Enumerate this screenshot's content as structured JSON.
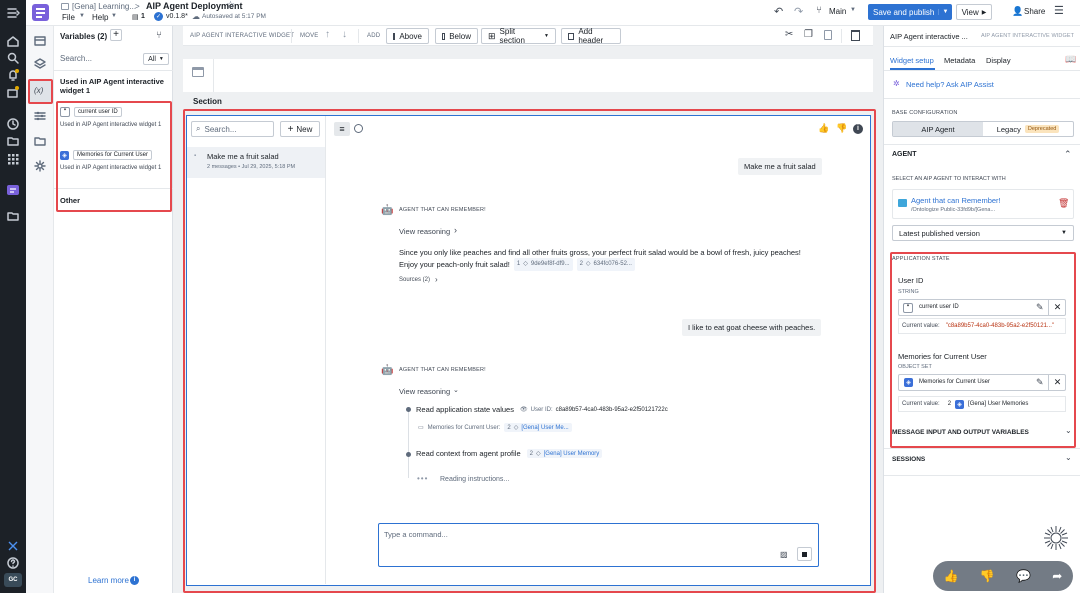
{
  "topbar": {
    "breadcrumb_parent": "[Gena] Learning...",
    "breadcrumb_sep": ">",
    "title": "AIP Agent Deployment",
    "menu_file": "File",
    "menu_help": "Help",
    "count": "1",
    "version": "v0.1.8*",
    "autosave": "Autosaved at 5:17 PM",
    "branch": "Main",
    "save_publish": "Save and publish",
    "view": "View",
    "share": "Share"
  },
  "variables": {
    "title": "Variables (2)",
    "search_placeholder": "Search...",
    "filter": "All",
    "section_used": "Used in AIP Agent interactive widget 1",
    "items": [
      {
        "name": "current user ID",
        "usage_prefix": "Used in",
        "usage": "AIP Agent interactive widget 1"
      },
      {
        "name": "Memories for Current User",
        "usage_prefix": "Used in",
        "usage": "AIP Agent interactive widget 1"
      }
    ],
    "section_other": "Other",
    "learn_more": "Learn more"
  },
  "toolbar": {
    "widget_label": "AIP AGENT INTERACTIVE WIDGET",
    "move_label": "MOVE",
    "add_label": "ADD",
    "above": "Above",
    "below": "Below",
    "split": "Split section",
    "add_header": "Add header"
  },
  "section_label": "Section",
  "chat": {
    "search_placeholder": "Search...",
    "new_button": "New",
    "conversation_title": "Make me a fruit salad",
    "conversation_meta": "2 messages • Jul 29, 2025, 5:18 PM",
    "user_message_1": "Make me a fruit salad",
    "agent_label": "AGENT THAT CAN REMEMBER!",
    "view_reasoning": "View reasoning",
    "agent_reply_line1": "Since you only like peaches and find all other fruits gross, your perfect fruit salad would be a bowl of fresh, juicy peaches!",
    "agent_reply_line2": "Enjoy your peach-only fruit salad!",
    "ref1_count": "1",
    "ref1_id": "9de9ef8f-df9...",
    "ref2_count": "2",
    "ref2_id": "634fc076-52...",
    "sources": "Sources (2)",
    "user_message_2": "I like to eat goat cheese with peaches.",
    "agent_label_2": "AGENT THAT CAN REMEMBER!",
    "view_reasoning_2": "View reasoning",
    "step1_title": "Read application state values",
    "step1_user_label": "User ID:",
    "step1_user_value": "c8a89b57-4ca0-483b-95a2-e2f50121722c",
    "step1_mem_label": "Memories for Current User:",
    "step1_mem_count": "2",
    "step1_mem_value": "[Gena] User Me...",
    "step2_title": "Read context from agent profile",
    "step2_count": "2",
    "step2_value": "[Gena] User Memory",
    "step3": "Reading instructions...",
    "input_placeholder": "Type a command..."
  },
  "right_panel": {
    "header_title": "AIP Agent interactive ...",
    "header_sub": "AIP AGENT INTERACTIVE WIDGET",
    "tabs": [
      "Widget setup",
      "Metadata",
      "Display"
    ],
    "help": "Need help? Ask AIP Assist",
    "base_config": "BASE CONFIGURATION",
    "seg_aip": "AIP Agent",
    "seg_legacy": "Legacy",
    "deprecated": "Deprecated",
    "agent_section": "AGENT",
    "select_agent": "SELECT AN AIP AGENT TO INTERACT WITH",
    "agent_name": "Agent that can Remember!",
    "agent_path": "/Ontologize Public-33fd9b/[Gena...",
    "version_select": "Latest published version",
    "app_state": "APPLICATION STATE",
    "var1_title": "User ID",
    "var1_type": "STRING",
    "var1_chip": "current user ID",
    "var1_current_label": "Current value:",
    "var1_current_value": "\"c8a89b57-4ca0-483b-95a2-e2f50121...\"",
    "var2_title": "Memories for Current User",
    "var2_type": "OBJECT SET",
    "var2_chip": "Memories for Current User",
    "var2_current_label": "Current value:",
    "var2_count": "2",
    "var2_current_value": "[Gena] User Memories",
    "section_msg": "MESSAGE INPUT AND OUTPUT VARIABLES",
    "section_sessions": "SESSIONS"
  },
  "nav_user_initials": "GC",
  "colors": {
    "primary": "#2d72d2",
    "nav_bg": "#1c2127",
    "highlight": "#e5484d",
    "accent_purple": "#7961db"
  }
}
